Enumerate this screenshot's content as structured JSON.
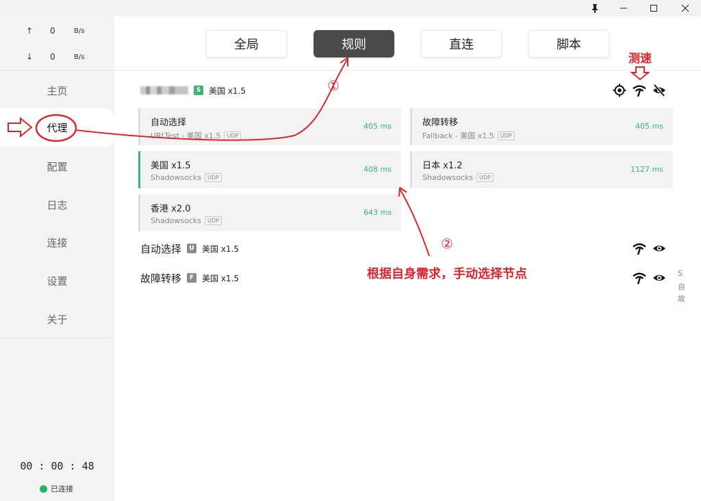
{
  "titlebar": {
    "pin_icon": "pin-icon",
    "minimize_icon": "minimize-icon",
    "maximize_icon": "maximize-icon",
    "close_icon": "close-icon"
  },
  "traffic": {
    "up_arrow": "↑",
    "up_value": "0",
    "up_unit": "B/s",
    "down_arrow": "↓",
    "down_value": "0",
    "down_unit": "B/s"
  },
  "nav": [
    {
      "label": "主页"
    },
    {
      "label": "代理"
    },
    {
      "label": "配置"
    },
    {
      "label": "日志"
    },
    {
      "label": "连接"
    },
    {
      "label": "设置"
    },
    {
      "label": "关于"
    }
  ],
  "timer": "00 : 00 : 48",
  "status": {
    "label": "已连接",
    "color": "#27b26b"
  },
  "modes": [
    {
      "label": "全局"
    },
    {
      "label": "规则"
    },
    {
      "label": "直连"
    },
    {
      "label": "脚本"
    }
  ],
  "groups": [
    {
      "badge": "S",
      "selected": "美国 x1.5"
    },
    {
      "name": "自动选择",
      "badge": "U",
      "selected": "美国 x1.5"
    },
    {
      "name": "故障转移",
      "badge": "F",
      "selected": "美国 x1.5"
    }
  ],
  "proxies": [
    {
      "name": "自动选择",
      "type": "URLTest - 美国 x1.5",
      "udp": "UDP",
      "delay": "405 ms"
    },
    {
      "name": "故障转移",
      "type": "Fallback - 美国 x1.5",
      "udp": "UDP",
      "delay": "405 ms"
    },
    {
      "name": "美国 x1.5",
      "type": "Shadowsocks",
      "udp": "UDP",
      "delay": "408 ms"
    },
    {
      "name": "日本 x1.2",
      "type": "Shadowsocks",
      "udp": "UDP",
      "delay": "1127 ms"
    },
    {
      "name": "香港 x2.0",
      "type": "Shadowsocks",
      "udp": "UDP",
      "delay": "643 ms"
    }
  ],
  "side_letters": [
    "S",
    "自",
    "故"
  ],
  "annotations": {
    "speed_test": "测速",
    "step1": "①",
    "step2": "②",
    "hint": "根据自身需求，手动选择节点",
    "color": "#d9262e"
  },
  "accent_color": "#3cb37a"
}
